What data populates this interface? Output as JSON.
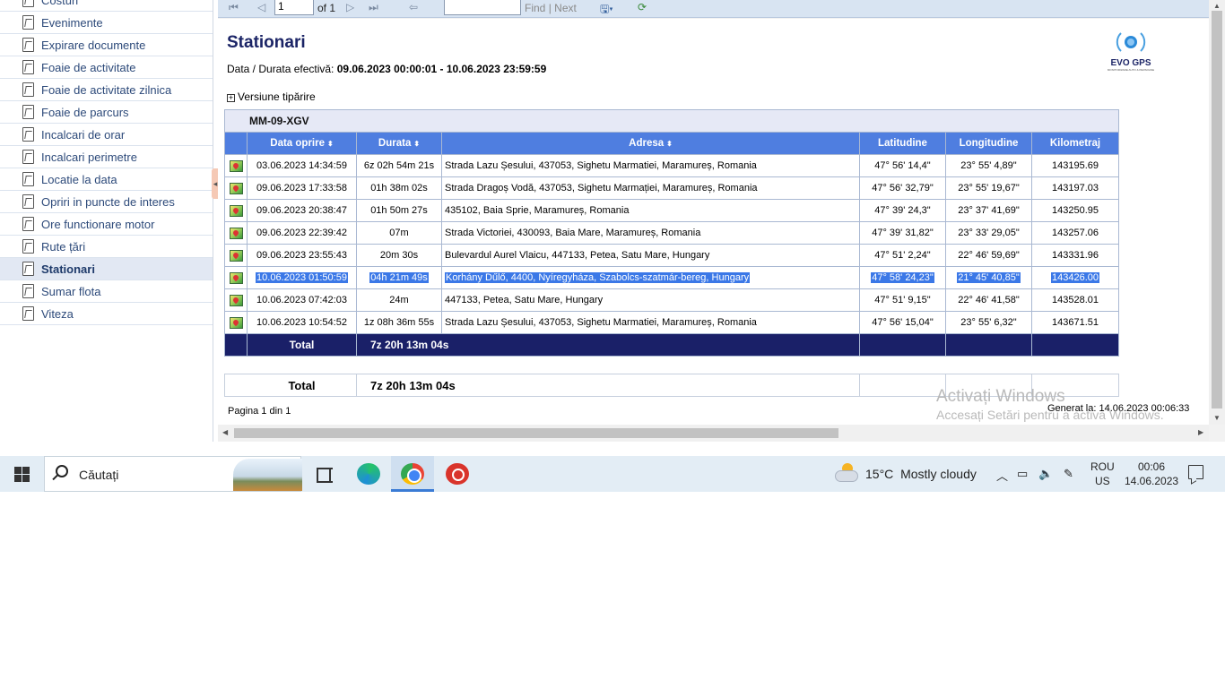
{
  "sidebar": {
    "items": [
      {
        "label": "Costuri"
      },
      {
        "label": "Evenimente"
      },
      {
        "label": "Expirare documente"
      },
      {
        "label": "Foaie de activitate"
      },
      {
        "label": "Foaie de activitate zilnica"
      },
      {
        "label": "Foaie de parcurs"
      },
      {
        "label": "Incalcari de orar"
      },
      {
        "label": "Incalcari perimetre"
      },
      {
        "label": "Locatie la data"
      },
      {
        "label": "Opriri in puncte de interes"
      },
      {
        "label": "Ore functionare motor"
      },
      {
        "label": "Rute țări"
      },
      {
        "label": "Stationari",
        "active": true
      },
      {
        "label": "Sumar flota"
      },
      {
        "label": "Viteza"
      }
    ]
  },
  "toolbar": {
    "page_value": "1",
    "of_label": "of 1",
    "find_label": "Find",
    "separator": "|",
    "next_label": "Next"
  },
  "report": {
    "title": "Stationari",
    "period_label": "Data / Durata efectivă:",
    "period_value": "09.06.2023 00:00:01 - 10.06.2023 23:59:59",
    "logo_text": "EVO GPS",
    "logo_sub": "MONITORIZARE AUTO & PERSOANE",
    "print_toggle": "Versiune tipărire",
    "group_label": "MM-09-XGV",
    "columns": [
      "Data oprire",
      "Durata",
      "Adresa",
      "Latitudine",
      "Longitudine",
      "Kilometraj"
    ],
    "rows": [
      {
        "date": "03.06.2023 14:34:59",
        "duration": "6z 02h 54m 21s",
        "address": "Strada Lazu Șesului,  437053, Sighetu Marmatiei, Maramureș, Romania",
        "lat": "47° 56' 14,4\"",
        "lon": "23° 55' 4,89\"",
        "km": "143195.69"
      },
      {
        "date": "09.06.2023 17:33:58",
        "duration": "01h 38m 02s",
        "address": "Strada Dragoș Vodă,  437053, Sighetu Marmației, Maramureș, Romania",
        "lat": "47° 56' 32,79\"",
        "lon": "23° 55' 19,67\"",
        "km": "143197.03"
      },
      {
        "date": "09.06.2023 20:38:47",
        "duration": "01h 50m 27s",
        "address": "435102, Baia Sprie, Maramureș, Romania",
        "lat": "47° 39' 24,3\"",
        "lon": "23° 37' 41,69\"",
        "km": "143250.95"
      },
      {
        "date": "09.06.2023 22:39:42",
        "duration": "07m",
        "address": "Strada Victoriei,  430093, Baia Mare, Maramureș, Romania",
        "lat": "47° 39' 31,82\"",
        "lon": "23° 33' 29,05\"",
        "km": "143257.06"
      },
      {
        "date": "09.06.2023 23:55:43",
        "duration": "20m 30s",
        "address": "Bulevardul Aurel Vlaicu,  447133, Petea, Satu Mare, Hungary",
        "lat": "47° 51' 2,24\"",
        "lon": "22° 46' 59,69\"",
        "km": "143331.96"
      },
      {
        "date": "10.06.2023 01:50:59",
        "duration": "04h 21m 49s",
        "address": "Korhány Dűlő,  4400, Nyíregyháza, Szabolcs-szatmár-bereg, Hungary",
        "lat": "47° 58' 24,23\"",
        "lon": "21° 45' 40,85\"",
        "km": "143426.00",
        "selected": true
      },
      {
        "date": "10.06.2023 07:42:03",
        "duration": "24m",
        "address": "447133, Petea, Satu Mare, Hungary",
        "lat": "47° 51' 9,15\"",
        "lon": "22° 46' 41,58\"",
        "km": "143528.01"
      },
      {
        "date": "10.06.2023 10:54:52",
        "duration": "1z 08h 36m 55s",
        "address": "Strada Lazu Șesului,  437053, Sighetu Marmatiei, Maramureș, Romania",
        "lat": "47° 56' 15,04\"",
        "lon": "23° 55' 6,32\"",
        "km": "143671.51"
      }
    ],
    "total_label": "Total",
    "total_value": "7z 20h 13m 04s",
    "grand_total_label": "Total",
    "grand_total_value": "7z 20h 13m 04s",
    "page_info": "Pagina 1 din 1",
    "generated": "Generat la:  14.06.2023 00:06:33"
  },
  "watermark": {
    "line1": "Activați Windows",
    "line2": "Accesați Setări pentru a activa Windows."
  },
  "taskbar": {
    "search_placeholder": "Căutați",
    "weather_temp": "15°C",
    "weather_desc": "Mostly cloudy",
    "lang_top": "ROU",
    "lang_bottom": "US",
    "time": "00:06",
    "date": "14.06.2023"
  },
  "colors": {
    "header_blue": "#4f7ee0",
    "total_navy": "#1a2068",
    "title_navy": "#1b2466",
    "selection": "#3b78e7"
  }
}
